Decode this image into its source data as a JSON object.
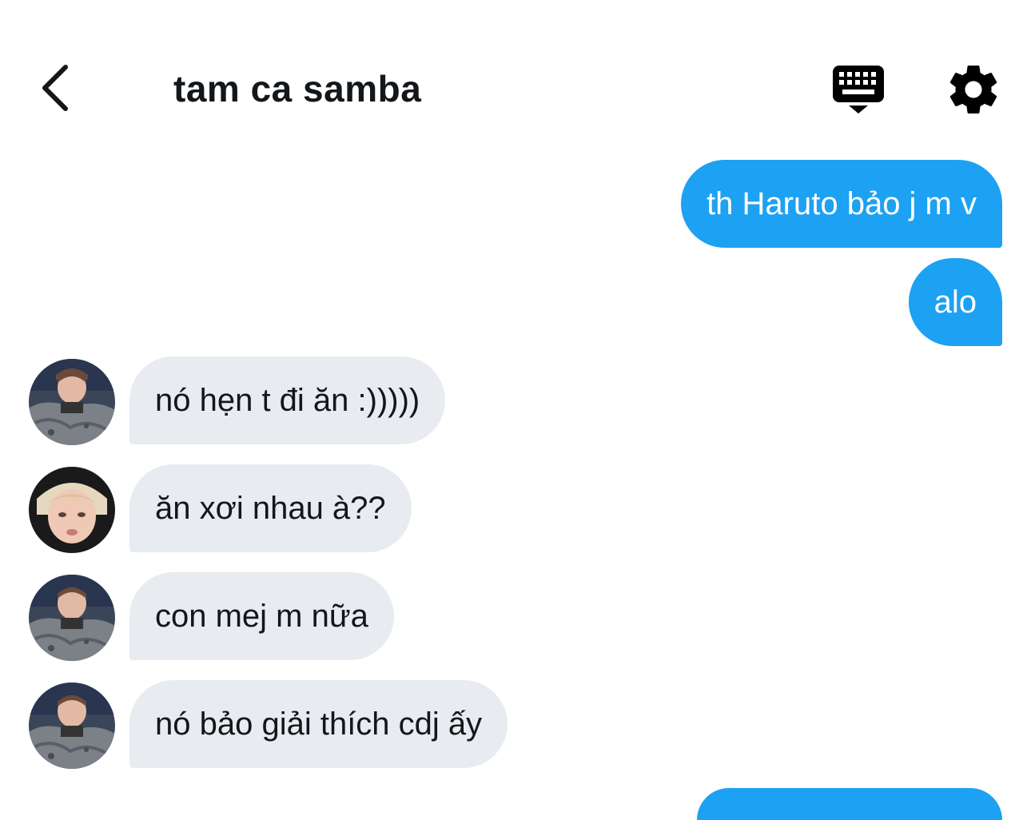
{
  "header": {
    "title": "tam ca samba",
    "back_icon": "chevron-left-icon",
    "keyboard_icon": "keyboard-icon",
    "settings_icon": "gear-icon"
  },
  "colors": {
    "sent_bubble": "#1da1f2",
    "received_bubble": "#e8ecf0",
    "text": "#14171a"
  },
  "messages": [
    {
      "direction": "sent",
      "text": "th Haruto bảo j m v"
    },
    {
      "direction": "sent",
      "text": "alo"
    },
    {
      "direction": "received",
      "avatar": "avatar-dark-jacket",
      "text": "nó hẹn t đi ăn :)))))"
    },
    {
      "direction": "received",
      "avatar": "avatar-blonde",
      "text": "ăn xơi nhau à??"
    },
    {
      "direction": "received",
      "avatar": "avatar-dark-jacket",
      "text": "con mej m nữa"
    },
    {
      "direction": "received",
      "avatar": "avatar-dark-jacket",
      "text": "nó bảo giải thích cdj ấy"
    }
  ]
}
